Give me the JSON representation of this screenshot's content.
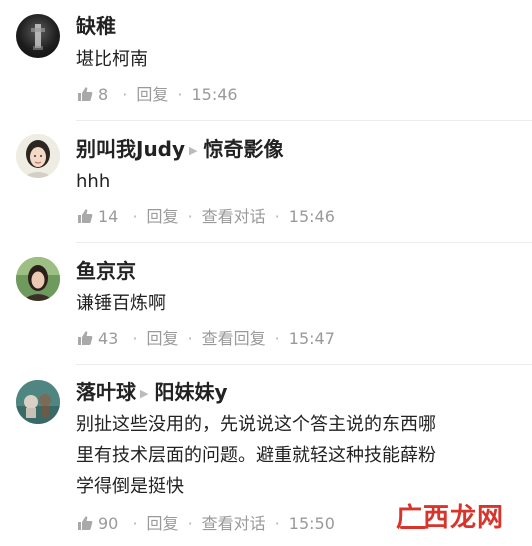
{
  "colors": {
    "text": "#222222",
    "meta": "#9a9a9a",
    "watermark": "#d7342c"
  },
  "comments": [
    {
      "username": "缺稚",
      "text": "堪比柯南",
      "likes": "8",
      "reply_label": "回复",
      "time": "15:46"
    },
    {
      "username": "别叫我Judy",
      "reply_to": "惊奇影像",
      "text": "hhh",
      "likes": "14",
      "reply_label": "回复",
      "view_label": "查看对话",
      "time": "15:46"
    },
    {
      "username": "鱼京京",
      "text": "谦锤百炼啊",
      "likes": "43",
      "reply_label": "回复",
      "view_label": "查看回复",
      "time": "15:47"
    },
    {
      "username": "落叶球",
      "reply_to": "阳妹妹y",
      "text_lines": [
        "别扯这些没用的，先说说这个答主说的东西哪",
        "里有技术层面的问题。避重就轻这种技能薛粉",
        "学得倒是挺快"
      ],
      "likes": "90",
      "reply_label": "回复",
      "view_label": "查看对话",
      "time": "15:50"
    }
  ],
  "watermark": "广西龙网"
}
